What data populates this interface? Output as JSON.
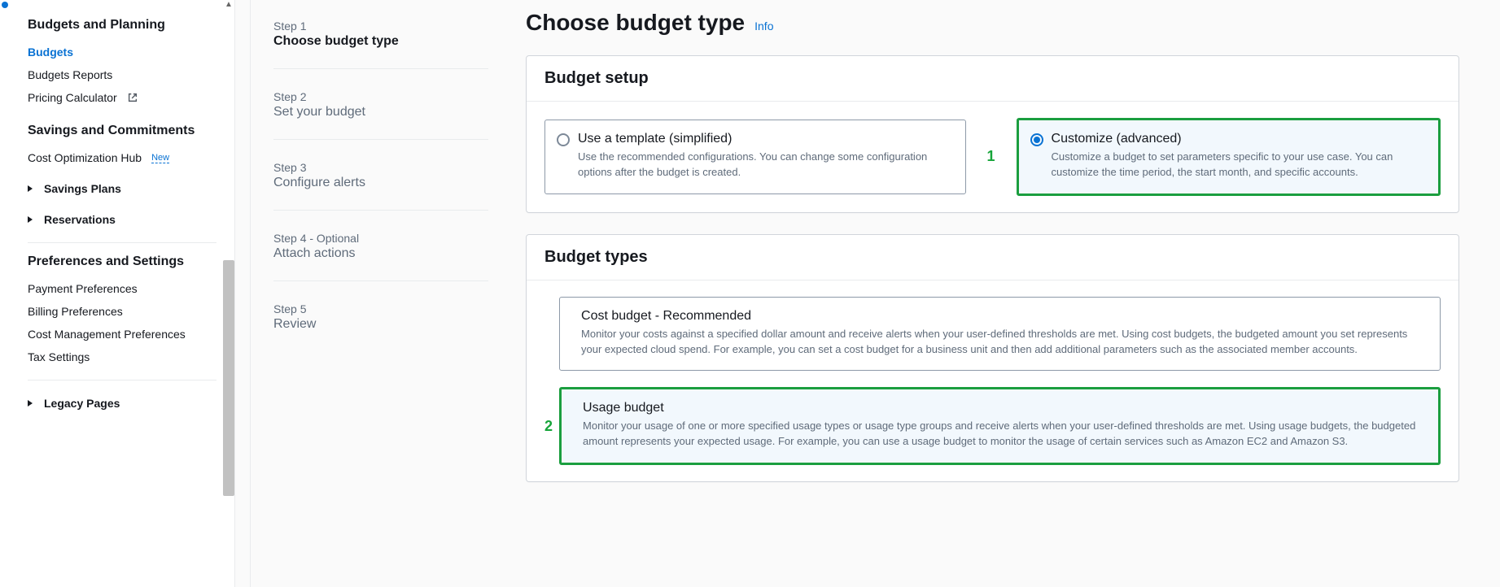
{
  "sidebar": {
    "section_budgets_title": "Budgets and Planning",
    "budgets": "Budgets",
    "budgets_reports": "Budgets Reports",
    "pricing_calculator": "Pricing Calculator",
    "section_savings_title": "Savings and Commitments",
    "cost_opt_hub": "Cost Optimization Hub",
    "new_badge": "New",
    "savings_plans": "Savings Plans",
    "reservations": "Reservations",
    "section_prefs_title": "Preferences and Settings",
    "payment_prefs": "Payment Preferences",
    "billing_prefs": "Billing Preferences",
    "cost_mgmt_prefs": "Cost Management Preferences",
    "tax_settings": "Tax Settings",
    "legacy_pages": "Legacy Pages"
  },
  "steps": {
    "s1_label": "Step 1",
    "s1_title": "Choose budget type",
    "s2_label": "Step 2",
    "s2_title": "Set your budget",
    "s3_label": "Step 3",
    "s3_title": "Configure alerts",
    "s4_label": "Step 4 - Optional",
    "s4_title": "Attach actions",
    "s5_label": "Step 5",
    "s5_title": "Review"
  },
  "page": {
    "title": "Choose budget type",
    "info": "Info"
  },
  "setup": {
    "panel_title": "Budget setup",
    "template_label": "Use a template (simplified)",
    "template_desc": "Use the recommended configurations. You can change some configuration options after the budget is created.",
    "customize_label": "Customize (advanced)",
    "customize_desc": "Customize a budget to set parameters specific to your use case. You can customize the time period, the start month, and specific accounts.",
    "callout1": "1"
  },
  "types": {
    "panel_title": "Budget types",
    "cost_label": "Cost budget - Recommended",
    "cost_desc": "Monitor your costs against a specified dollar amount and receive alerts when your user-defined thresholds are met. Using cost budgets, the budgeted amount you set represents your expected cloud spend. For example, you can set a cost budget for a business unit and then add additional parameters such as the associated member accounts.",
    "usage_label": "Usage budget",
    "usage_desc": "Monitor your usage of one or more specified usage types or usage type groups and receive alerts when your user-defined thresholds are met. Using usage budgets, the budgeted amount represents your expected usage. For example, you can use a usage budget to monitor the usage of certain services such as Amazon EC2 and Amazon S3.",
    "callout2": "2"
  }
}
